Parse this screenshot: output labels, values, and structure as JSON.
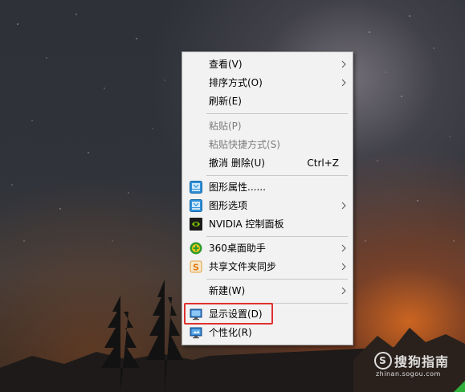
{
  "context_menu": {
    "items": [
      {
        "label": "查看(V)"
      },
      {
        "label": "排序方式(O)"
      },
      {
        "label": "刷新(E)"
      },
      {
        "label": "粘贴(P)"
      },
      {
        "label": "粘贴快捷方式(S)"
      },
      {
        "label": "撤消 删除(U)",
        "shortcut": "Ctrl+Z"
      },
      {
        "label": "图形属性......"
      },
      {
        "label": "图形选项"
      },
      {
        "label": "NVIDIA 控制面板"
      },
      {
        "label": "360桌面助手"
      },
      {
        "label": "共享文件夹同步"
      },
      {
        "label": "新建(W)"
      },
      {
        "label": "显示设置(D)"
      },
      {
        "label": "个性化(R)"
      }
    ]
  },
  "watermark": {
    "brand": "搜狗指南",
    "site": "zhinan.sogou.com"
  },
  "colors": {
    "menu_bg": "#f2f2f2",
    "highlight_border": "#e0312f",
    "disabled_text": "#7d7d7d"
  }
}
